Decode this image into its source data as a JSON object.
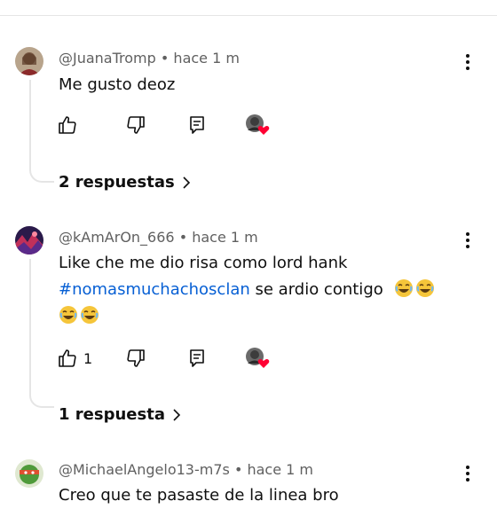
{
  "comments": [
    {
      "author": "@JuanaTromp",
      "time": "hace 1 m",
      "text": "Me gusto deoz",
      "likes": "",
      "replies_label": "2 respuestas"
    },
    {
      "author": "@kAmArOn_666",
      "time": "hace 1 m",
      "text_line1": "Like che me dio risa como lord hank",
      "hashtag": "#nomasmuchachosclan",
      "text_after_hashtag": " se ardio contigo",
      "likes": "1",
      "replies_label": "1 respuesta"
    },
    {
      "author": "@MichaelAngelo13-m7s",
      "time": "hace 1 m",
      "text": "Creo que te pasaste de la linea bro"
    }
  ],
  "colors": {
    "text": "#0f0f0f",
    "meta": "#606060",
    "hashtag": "#065fd4",
    "heart": "#ff0033",
    "thread": "#e5e5e5"
  },
  "icons": [
    "like-icon",
    "dislike-icon",
    "reply-icon",
    "creator-heart-icon",
    "more-vert-icon",
    "chevron-right-icon",
    "laughing-emoji-icon"
  ]
}
